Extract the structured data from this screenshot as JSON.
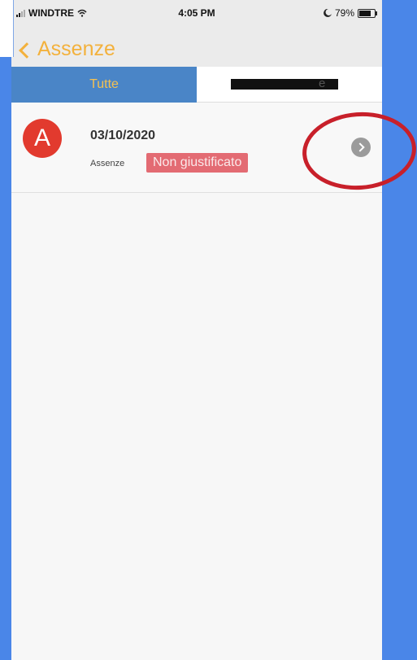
{
  "status_bar": {
    "carrier": "WINDTRE",
    "time": "4:05 PM",
    "battery": "79%",
    "battery_fill": 0.79
  },
  "nav": {
    "back_label": "Assenze"
  },
  "segments": {
    "tab_all": "Tutte",
    "tab_other_suffix": "e"
  },
  "list": {
    "items": [
      {
        "avatar_letter": "A",
        "date": "03/10/2020",
        "type": "Assenze",
        "status": "Non giustificato"
      }
    ]
  },
  "colors": {
    "accent": "#f3b13c",
    "segment_active": "#4a85c7",
    "badge": "#e36b73",
    "avatar": "#e23a2e",
    "annotation_circle": "#c8202a",
    "background_frame": "#4a86e8"
  },
  "icons": {
    "back": "chevron-left-icon",
    "disclosure": "chevron-right-circle-icon",
    "wifi": "wifi-icon",
    "moon": "moon-icon",
    "battery": "battery-icon"
  }
}
